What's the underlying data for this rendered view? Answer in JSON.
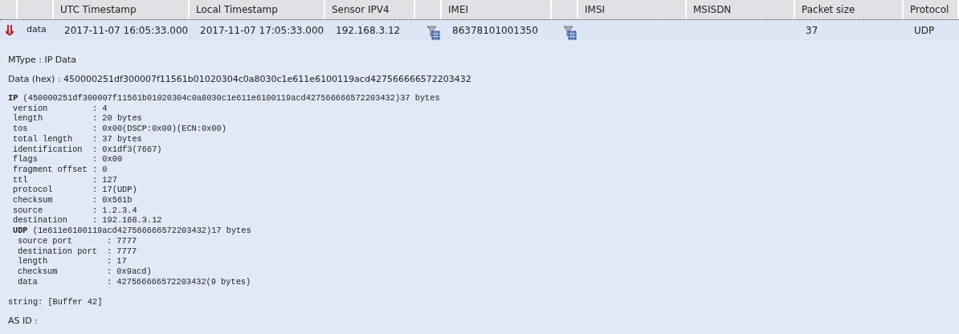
{
  "table": {
    "columns": [
      {
        "kind": "blank"
      },
      {
        "kind": "blank"
      },
      {
        "kind": "text",
        "label": "UTC Timestamp"
      },
      {
        "kind": "text",
        "label": "Local Timestamp"
      },
      {
        "kind": "text",
        "label": "Sensor IPV4"
      },
      {
        "kind": "blank"
      },
      {
        "kind": "text",
        "label": "IMEI"
      },
      {
        "kind": "blank"
      },
      {
        "kind": "text",
        "label": "IMSI"
      },
      {
        "kind": "text",
        "label": "MSISDN"
      },
      {
        "kind": "text",
        "label": "Packet size"
      },
      {
        "kind": "text",
        "label": "Protocol"
      }
    ],
    "rows": [
      {
        "expanded": true,
        "cells": [
          {
            "kind": "arrow"
          },
          {
            "kind": "type",
            "text": "data"
          },
          {
            "kind": "text",
            "text": "2017-11-07 16:05:33.000"
          },
          {
            "kind": "text",
            "text": "2017-11-07 17:05:33.000"
          },
          {
            "kind": "text",
            "text": "192.168.3.12"
          },
          {
            "kind": "filter"
          },
          {
            "kind": "text",
            "text": "86378101001350"
          },
          {
            "kind": "filter"
          },
          {
            "kind": "empty"
          },
          {
            "kind": "empty"
          },
          {
            "kind": "text",
            "text": "37"
          },
          {
            "kind": "text",
            "text": "UDP"
          }
        ]
      }
    ]
  },
  "details": {
    "mtype": "MType : IP Data",
    "data_hex": "Data (hex) : 450000251df300007f11561b01020304c0a8030c1e611e6100119acd427566666572203432",
    "decode": {
      "protocol": "IP",
      "summary": "(450000251df300007f11561b01020304c0a8030c1e611e6100119acd427566666572203432)37 bytes",
      "fields": [
        {
          "name": "version",
          "value": ": 4"
        },
        {
          "name": "length",
          "value": ": 20 bytes"
        },
        {
          "name": "tos",
          "value": ": 0x00(DSCP:0x00)(ECN:0x00)"
        },
        {
          "name": "total length",
          "value": ": 37 bytes"
        },
        {
          "name": "identification",
          "value": ": 0x1df3(7667)"
        },
        {
          "name": "flags",
          "value": ": 0x00"
        },
        {
          "name": "fragment offset",
          "value": ": 0"
        },
        {
          "name": "ttl",
          "value": ": 127"
        },
        {
          "name": "protocol",
          "value": ": 17(UDP)"
        },
        {
          "name": "checksum",
          "value": ": 0x561b"
        },
        {
          "name": "source",
          "value": ": 1.2.3.4"
        },
        {
          "name": "destination",
          "value": ": 192.168.3.12"
        }
      ],
      "children": [
        {
          "protocol": "UDP",
          "summary": "(1e611e6100119acd427566666572203432)17 bytes",
          "fields": [
            {
              "name": "source port",
              "value": ": 7777"
            },
            {
              "name": "destination port",
              "value": ": 7777"
            },
            {
              "name": "length",
              "value": ": 17"
            },
            {
              "name": "checksum",
              "value": ": 0x9acd)"
            },
            {
              "name": "data",
              "value": ": 427566666572203432(9 bytes)"
            }
          ]
        }
      ]
    },
    "string": "string: [Buffer 42]",
    "as_id": "AS ID :"
  }
}
